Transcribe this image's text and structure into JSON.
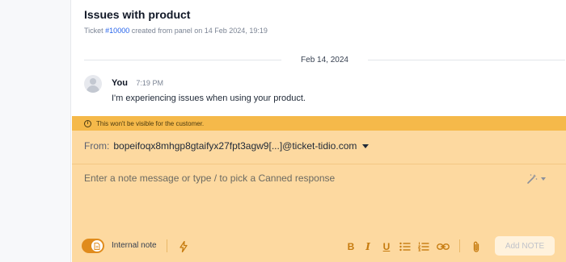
{
  "ticket": {
    "title": "Issues with product",
    "subtitle_prefix": "Ticket ",
    "ticket_id": "#10000",
    "subtitle_suffix": " created from panel on 14 Feb 2024, 19:19"
  },
  "conversation": {
    "date_separator": "Feb 14, 2024",
    "messages": [
      {
        "author": "You",
        "time": "7:19 PM",
        "text": "I'm experiencing issues when using your product."
      }
    ]
  },
  "notice": {
    "icon": "info-icon",
    "text": "This won't be visible for the customer."
  },
  "composer": {
    "from_label": "From:",
    "from_address": "bopeifoqx8mhgp8gtaifyx27fpt3agw9[...]@ticket-tidio.com",
    "placeholder": "Enter a note message or type / to pick a Canned response",
    "value": ""
  },
  "toolbar": {
    "internal_note_label": "Internal note",
    "internal_note_enabled": true,
    "add_note_label": "Add NOTE",
    "icons": [
      "note-toggle-icon",
      "lightning-icon",
      "bold-icon",
      "italic-icon",
      "underline-icon",
      "bulleted-list-icon",
      "numbered-list-icon",
      "link-icon",
      "attachment-icon",
      "magic-wand-icon"
    ]
  },
  "colors": {
    "accent": "#e08b1c",
    "notice_bg": "#f5b94a",
    "composer_bg": "#fdd9a0",
    "link": "#2563eb"
  }
}
